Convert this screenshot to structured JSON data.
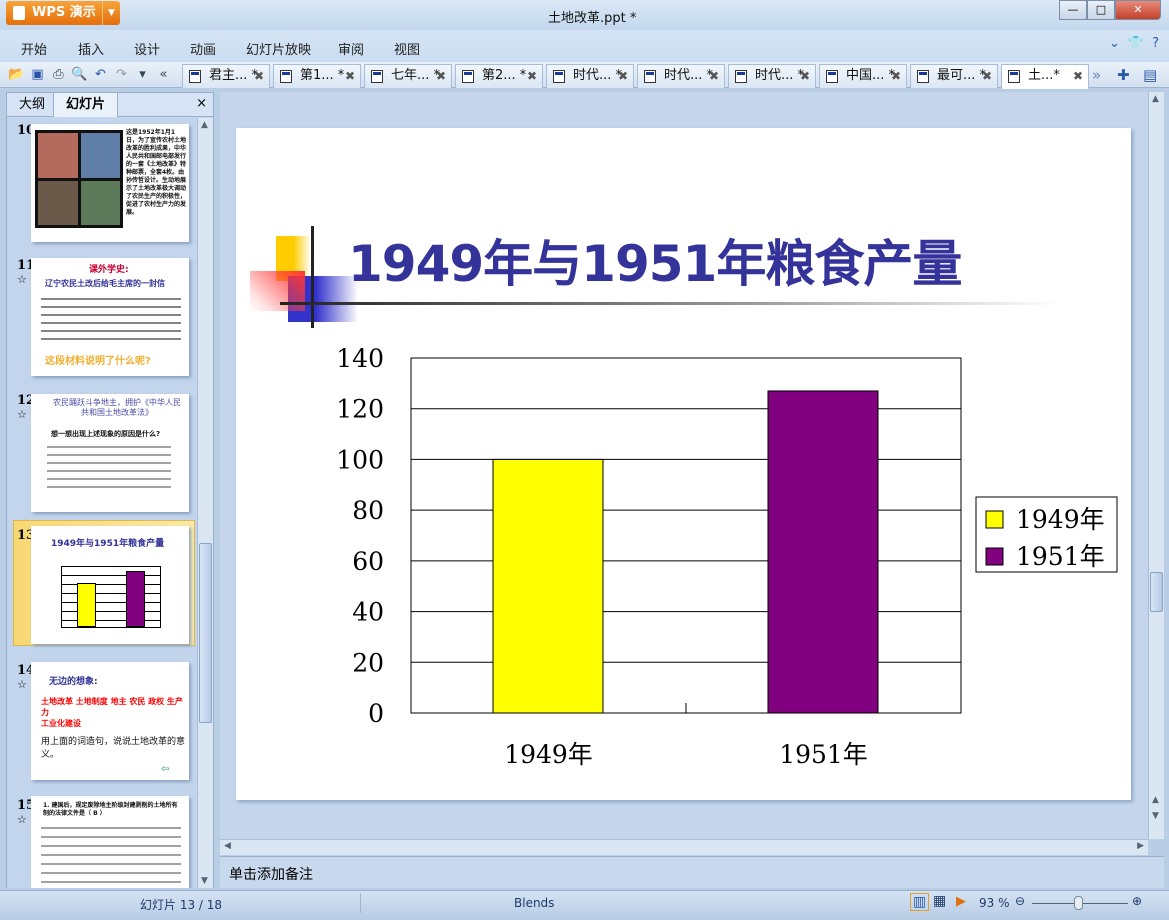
{
  "app": {
    "name": "WPS 演示",
    "document_title": "土地改革.ppt *"
  },
  "menu": [
    "开始",
    "插入",
    "设计",
    "动画",
    "幻灯片放映",
    "审阅",
    "视图"
  ],
  "doc_tabs": [
    {
      "label": "君主... *"
    },
    {
      "label": "第1... *"
    },
    {
      "label": "七年... *"
    },
    {
      "label": "第2... *"
    },
    {
      "label": "时代... *"
    },
    {
      "label": "时代... *"
    },
    {
      "label": "时代... *"
    },
    {
      "label": "中国... *"
    },
    {
      "label": "最可... *"
    },
    {
      "label": "土...*",
      "active": true
    }
  ],
  "panel": {
    "tab_outline": "大纲",
    "tab_slides": "幻灯片",
    "close": "×"
  },
  "thumbnails": [
    {
      "num": "10",
      "text": "这是1952年1月1日，为了宣传农村土地改革的胜利成果，中华人民共和国邮电部发行的一套《土地改革》特种邮票，全套4枚。由孙传哲设计。生动地展示了土地改革极大调动了农民生产的积极性，促进了农村生产力的发展。"
    },
    {
      "num": "11",
      "star": true,
      "heading": "课外学史:",
      "title": "辽宁农民土改后给毛主席的一封信",
      "question": "这段材料说明了什么呢?"
    },
    {
      "num": "12",
      "star": true,
      "title": "农民踊跃斗争地主，拥护《中华人民共和国土地改革法》",
      "bullet": "想一想出现上述现象的原因是什么?"
    },
    {
      "num": "13",
      "title": "1949年与1951年粮食产量"
    },
    {
      "num": "14",
      "star": true,
      "title": "无边的想象:",
      "line1": "土地改革  土地制度  地主  农民  政权  生产力",
      "line2": "工业化建设",
      "line3": "用上面的词造句，说说土地改革的意义。"
    },
    {
      "num": "15",
      "star": true,
      "text": "1. 建国后，规定废除地主阶级封建剥削的土地所有制的法律文件是（ B ）"
    }
  ],
  "slide": {
    "title": "1949年与1951年粮食产量"
  },
  "chart_data": {
    "type": "bar",
    "categories": [
      "1949年",
      "1951年"
    ],
    "series": [
      {
        "name": "1949年",
        "values": [
          100,
          null
        ],
        "color": "#ffff00"
      },
      {
        "name": "1951年",
        "values": [
          null,
          127
        ],
        "color": "#800080"
      }
    ],
    "ylim": [
      0,
      140
    ],
    "yticks": [
      0,
      20,
      40,
      60,
      80,
      100,
      120,
      140
    ],
    "grid": true,
    "legend": "right"
  },
  "notes_placeholder": "单击添加备注",
  "status": {
    "slide_pos": "幻灯片 13 / 18",
    "theme": "Blends",
    "zoom": "93 %"
  }
}
